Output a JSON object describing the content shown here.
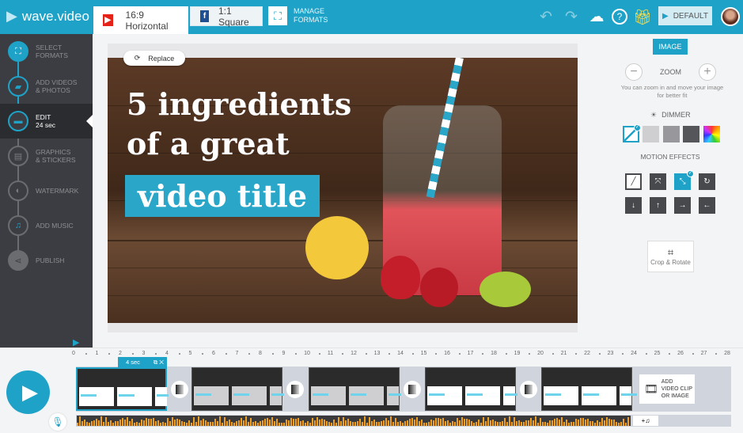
{
  "header": {
    "logo": "wave.video",
    "tabs": [
      {
        "label": "16:9 Horizontal",
        "icon": "youtube-icon",
        "active": true
      },
      {
        "label": "1:1 Square",
        "icon": "facebook-icon",
        "active": false
      }
    ],
    "manage_formats": [
      "MANAGE",
      "FORMATS"
    ],
    "default_label": "DEFAULT"
  },
  "sidebar": {
    "steps": [
      {
        "line1": "SELECT",
        "line2": "FORMATS",
        "state": "done"
      },
      {
        "line1": "ADD VIDEOS",
        "line2": "& PHOTOS",
        "state": "done"
      },
      {
        "line1": "EDIT",
        "line2": "24 sec",
        "state": "current"
      },
      {
        "line1": "GRAPHICS",
        "line2": "& STICKERS",
        "state": "todo"
      },
      {
        "line1": "WATERMARK",
        "line2": "",
        "state": "todo"
      },
      {
        "line1": "ADD MUSIC",
        "line2": "",
        "state": "todo"
      },
      {
        "line1": "PUBLISH",
        "line2": "",
        "state": "todo"
      }
    ]
  },
  "canvas": {
    "replace_label": "Replace",
    "title_line1": "5 ingredients",
    "title_line2": "of a great",
    "title_highlight": "video title"
  },
  "panel": {
    "image_tab": "IMAGE",
    "zoom_label": "ZOOM",
    "zoom_hint_1": "You can zoom in and move your image",
    "zoom_hint_2": "for better fit",
    "dimmer_label": "DIMMER",
    "dimmer_swatches": [
      "none",
      "#cfcfd1",
      "#98989c",
      "#55565a",
      "rainbow"
    ],
    "dimmer_selected": 0,
    "motion_label": "MOTION EFFECTS",
    "motion_selected": 2,
    "crop_label": "Crop & Rotate"
  },
  "timeline": {
    "ticks": [
      "0",
      "1",
      "2",
      "3",
      "4",
      "5",
      "6",
      "7",
      "8",
      "9",
      "10",
      "11",
      "12",
      "13",
      "14",
      "15",
      "16",
      "17",
      "18",
      "19",
      "20",
      "21",
      "22",
      "23",
      "24",
      "25",
      "26",
      "27",
      "28"
    ],
    "selected_clip_duration": "4 sec",
    "add_clip": [
      "ADD",
      "VIDEO CLIP",
      "OR IMAGE"
    ]
  },
  "colors": {
    "accent": "#1fa2c8",
    "sidebar": "#3c3d42",
    "audio": "#f0a020"
  }
}
